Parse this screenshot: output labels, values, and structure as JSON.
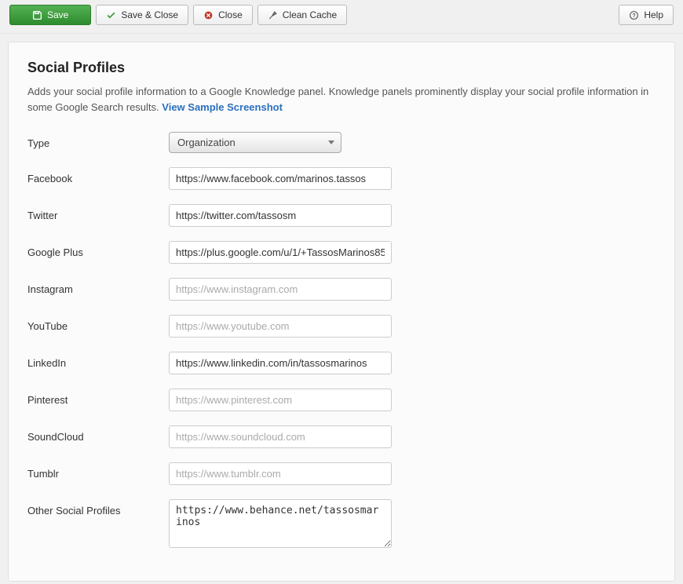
{
  "toolbar": {
    "save": "Save",
    "saveClose": "Save & Close",
    "close": "Close",
    "cleanCache": "Clean Cache",
    "help": "Help"
  },
  "panel": {
    "title": "Social Profiles",
    "description": "Adds your social profile information to a Google Knowledge panel. Knowledge panels prominently display your social profile information in some Google Search results.",
    "linkText": "View Sample Screenshot"
  },
  "fields": {
    "type": {
      "label": "Type",
      "selected": "Organization"
    },
    "facebook": {
      "label": "Facebook",
      "value": "https://www.facebook.com/marinos.tassos",
      "placeholder": ""
    },
    "twitter": {
      "label": "Twitter",
      "value": "https://twitter.com/tassosm",
      "placeholder": ""
    },
    "googleplus": {
      "label": "Google Plus",
      "value": "https://plus.google.com/u/1/+TassosMarinos85",
      "placeholder": ""
    },
    "instagram": {
      "label": "Instagram",
      "value": "",
      "placeholder": "https://www.instagram.com"
    },
    "youtube": {
      "label": "YouTube",
      "value": "",
      "placeholder": "https://www.youtube.com"
    },
    "linkedin": {
      "label": "LinkedIn",
      "value": "https://www.linkedin.com/in/tassosmarinos",
      "placeholder": ""
    },
    "pinterest": {
      "label": "Pinterest",
      "value": "",
      "placeholder": "https://www.pinterest.com"
    },
    "soundcloud": {
      "label": "SoundCloud",
      "value": "",
      "placeholder": "https://www.soundcloud.com"
    },
    "tumblr": {
      "label": "Tumblr",
      "value": "",
      "placeholder": "https://www.tumblr.com"
    },
    "other": {
      "label": "Other Social Profiles",
      "value": "https://www.behance.net/tassosmarinos"
    }
  }
}
